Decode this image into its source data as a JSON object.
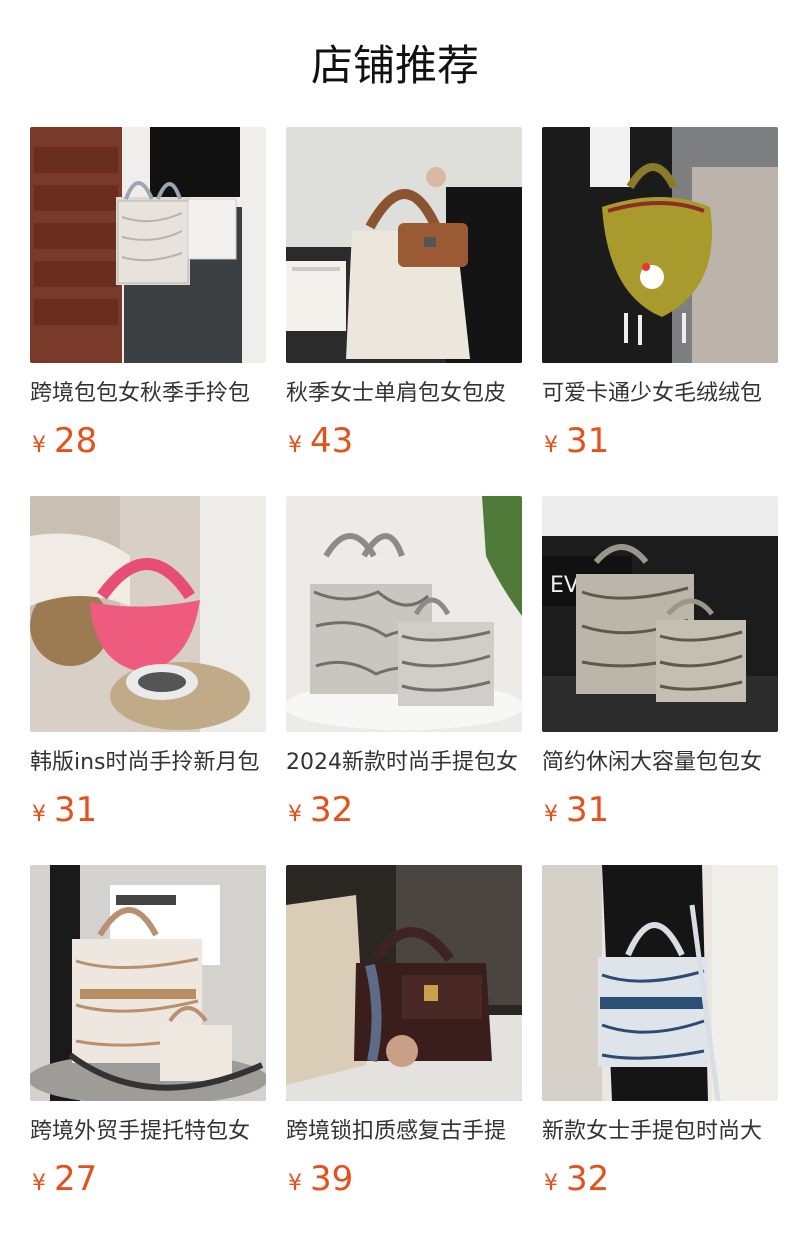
{
  "section_title": "店铺推荐",
  "currency_symbol": "¥",
  "price_color": "#e5501b",
  "products": [
    {
      "name": "跨境包包女秋季手拎包",
      "price": "28",
      "icon": "tote-bag-image"
    },
    {
      "name": "秋季女士单肩包女包皮",
      "price": "43",
      "icon": "handbag-image"
    },
    {
      "name": "可爱卡通少女毛绒绒包",
      "price": "31",
      "icon": "plush-bag-image"
    },
    {
      "name": "韩版ins时尚手拎新月包",
      "price": "31",
      "icon": "pink-crescent-bag-image"
    },
    {
      "name": "2024新款时尚手提包女",
      "price": "32",
      "icon": "jacquard-tote-image"
    },
    {
      "name": "简约休闲大容量包包女",
      "price": "31",
      "icon": "jacquard-tote-image"
    },
    {
      "name": "跨境外贸手提托特包女",
      "price": "27",
      "icon": "tote-set-image"
    },
    {
      "name": "跨境锁扣质感复古手提",
      "price": "39",
      "icon": "leather-bag-image"
    },
    {
      "name": "新款女士手提包时尚大",
      "price": "32",
      "icon": "blue-tote-image"
    }
  ]
}
